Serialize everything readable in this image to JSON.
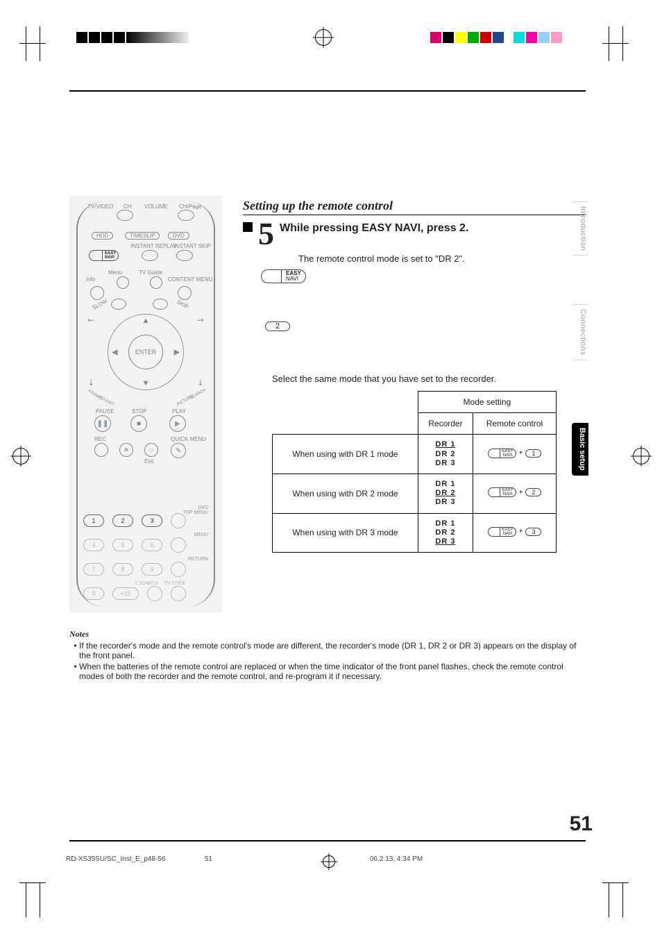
{
  "section_title": "Setting up the remote control",
  "step_number": "5",
  "instruction": "While pressing EASY NAVI, press 2.",
  "result_line": "The remote control mode is set to \"DR 2\".",
  "navi_label_top": "EASY",
  "navi_label_bot": "NAVI",
  "press_key": "2",
  "select_line": "Select the same mode that you have set to the recorder.",
  "table": {
    "header_mode_setting": "Mode setting",
    "header_recorder": "Recorder",
    "header_remote": "Remote control",
    "rows": [
      {
        "when": "When using with DR 1 mode",
        "dr": [
          "DR 1",
          "DR 2",
          "DR 3"
        ],
        "sel": 0,
        "key": "1"
      },
      {
        "when": "When using with DR 2 mode",
        "dr": [
          "DR 1",
          "DR 2",
          "DR 3"
        ],
        "sel": 1,
        "key": "2"
      },
      {
        "when": "When using with DR 3 mode",
        "dr": [
          "DR 1",
          "DR 2",
          "DR 3"
        ],
        "sel": 2,
        "key": "3"
      }
    ]
  },
  "tabs": {
    "a": "Introduction",
    "b": "Connections",
    "c": "Basic setup"
  },
  "notes_head": "Notes",
  "notes": [
    "If the recorder's mode and the remote control's mode are different, the recorder's mode (DR 1, DR 2 or DR 3) appears on the display of the front panel.",
    "When the batteries of the remote control are replaced or when the time indicator of the front panel flashes, check the remote control modes of both the recorder and the remote control, and re-program it if necessary."
  ],
  "page_number": "51",
  "footer": {
    "file": "RD-XS35SU/SC_Inst_E_p48-56",
    "page": "51",
    "stamp": "06.2.13, 4:34 PM"
  },
  "remote": {
    "row1": {
      "tvvideo": "TV/VIDEO",
      "ch": "CH",
      "volume": "VOLUME",
      "chpage": "CH/Page"
    },
    "row2": {
      "hdd": "HDD",
      "timeslip": "TIMESLIP",
      "dvd": "DVD",
      "instreplay": "INSTANT REPLAY",
      "instskip": "INSTANT SKIP",
      "easynavi": "EASY\nNAVI"
    },
    "row3": {
      "menu": "Menu",
      "info": "Info",
      "tvguide": "TV Guide",
      "content": "CONTENT MENU",
      "slow": "SLOW",
      "skip": "SKIP"
    },
    "enter": "ENTER",
    "diag": {
      "frame": "FRAME",
      "adjust": "ADJUST",
      "pic": "PICTURE",
      "search": "SEARCH"
    },
    "row5": {
      "pause": "PAUSE",
      "stop": "STOP",
      "play": "PLAY"
    },
    "row6": {
      "rec": "REC",
      "exit": "Exit",
      "quick": "QUICK MENU"
    },
    "numlabels": {
      "dvdtop": "DVD\nTOP MENU",
      "menu": "MENU",
      "ret": "RETURN",
      "tsearch": "T.SEARCH",
      "tvcode": "TV CODE",
      "plus10": "+10"
    },
    "plus": "+"
  }
}
